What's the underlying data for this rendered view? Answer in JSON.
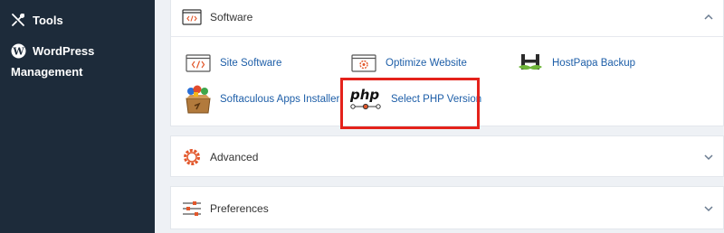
{
  "sidebar": {
    "tools_label": "Tools",
    "wordpress_label_line1": "WordPress",
    "wordpress_label_line2": "Management"
  },
  "software": {
    "title": "Software",
    "apps": [
      {
        "label": "Site Software",
        "icon": "code-icon"
      },
      {
        "label": "Optimize Website",
        "icon": "optimize-icon"
      },
      {
        "label": "HostPapa Backup",
        "icon": "hostpapa-logo-icon"
      },
      {
        "label": "Softaculous Apps Installer",
        "icon": "softaculous-box-icon"
      },
      {
        "label": "Select PHP Version",
        "icon": "php-icon"
      }
    ]
  },
  "advanced": {
    "title": "Advanced",
    "icon": "gear-icon"
  },
  "preferences": {
    "title": "Preferences",
    "icon": "sliders-icon"
  },
  "php_icon_text": "php",
  "colors": {
    "sidebar": "#1d2b3a",
    "link": "#1d5ea8",
    "highlight": "#e4221b",
    "accent": "#e2572b"
  }
}
